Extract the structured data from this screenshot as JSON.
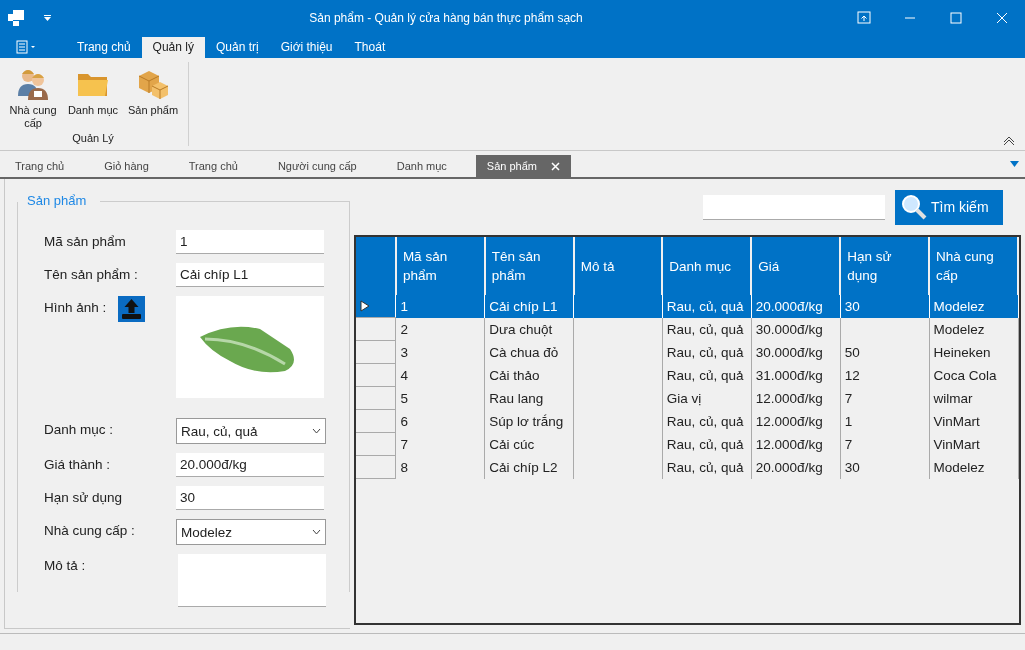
{
  "window": {
    "title": "Sản phẩm - Quản lý cửa hàng bán thực phẩm sạch"
  },
  "ribbon": {
    "tabs": [
      {
        "label": "Trang chủ",
        "selected": false
      },
      {
        "label": "Quản lý",
        "selected": true
      },
      {
        "label": "Quản trị",
        "selected": false
      },
      {
        "label": "Giới thiệu",
        "selected": false
      },
      {
        "label": "Thoát",
        "selected": false
      }
    ],
    "groups": [
      {
        "label": "Quản Lý",
        "buttons": [
          {
            "label": "Nhà cung cấp",
            "kind": "people"
          },
          {
            "label": "Danh mục",
            "kind": "folder"
          },
          {
            "label": "Sản phẩm",
            "kind": "boxes"
          }
        ]
      }
    ]
  },
  "doc_tabs": [
    {
      "label": "Trang chủ",
      "selected": false
    },
    {
      "label": "Giỏ hàng",
      "selected": false
    },
    {
      "label": "Trang chủ",
      "selected": false
    },
    {
      "label": "Người cung cấp",
      "selected": false
    },
    {
      "label": "Danh mục",
      "selected": false
    },
    {
      "label": "Sản phẩm",
      "selected": true
    }
  ],
  "panel": {
    "title": "Sản phẩm",
    "fields": [
      {
        "kind": "text",
        "label": "Mã sản phẩm",
        "value": "1"
      },
      {
        "kind": "text",
        "label": "Tên sản phẩm :",
        "value": "Cải chíp L1"
      },
      {
        "kind": "image",
        "label": "Hình ảnh :"
      },
      {
        "kind": "combo",
        "label": "Danh mục :",
        "value": "Rau, củ, quả"
      },
      {
        "kind": "text",
        "label": "Giá thành :",
        "value": "20.000đ/kg"
      },
      {
        "kind": "text",
        "label": "Hạn sử dụng",
        "value": "30"
      },
      {
        "kind": "combo",
        "label": "Nhà cung cấp :",
        "value": "Modelez"
      },
      {
        "kind": "textarea",
        "label": "Mô tả :"
      }
    ]
  },
  "search": {
    "button": "Tìm kiếm"
  },
  "table": {
    "columns": [
      "Mã sản phẩm",
      "Tên sản phẩm",
      "Mô tả",
      "Danh mục",
      "Giá",
      "Hạn sử dụng",
      "Nhà cung cấp"
    ],
    "rows": [
      {
        "selected": true,
        "cells": [
          "1",
          "Cải chíp L1",
          "",
          "Rau, củ, quả",
          "20.000đ/kg",
          "30",
          "Modelez"
        ]
      },
      {
        "selected": false,
        "cells": [
          "2",
          "Dưa chuột",
          "",
          "Rau, củ, quả",
          "30.000đ/kg",
          "",
          "Modelez"
        ]
      },
      {
        "selected": false,
        "cells": [
          "3",
          "Cà chua đỏ",
          "",
          "Rau, củ, quả",
          "30.000đ/kg",
          "50",
          "Heineken"
        ]
      },
      {
        "selected": false,
        "cells": [
          "4",
          "Cải thảo",
          "",
          "Rau, củ, quả",
          "31.000đ/kg",
          "12",
          "Coca Cola"
        ]
      },
      {
        "selected": false,
        "cells": [
          "5",
          "Rau lang",
          "",
          "Gia vị",
          "12.000đ/kg",
          "7",
          "wilmar"
        ]
      },
      {
        "selected": false,
        "cells": [
          "6",
          "Súp lơ trắng",
          "",
          "Rau, củ, quả",
          "12.000đ/kg",
          "1",
          "VinMart"
        ]
      },
      {
        "selected": false,
        "cells": [
          "7",
          "Cải cúc",
          "",
          "Rau, củ, quả",
          "12.000đ/kg",
          "7",
          "VinMart"
        ]
      },
      {
        "selected": false,
        "cells": [
          "8",
          "Cải chíp L2",
          "",
          "Rau, củ, quả",
          "20.000đ/kg",
          "30",
          "Modelez"
        ]
      }
    ]
  }
}
